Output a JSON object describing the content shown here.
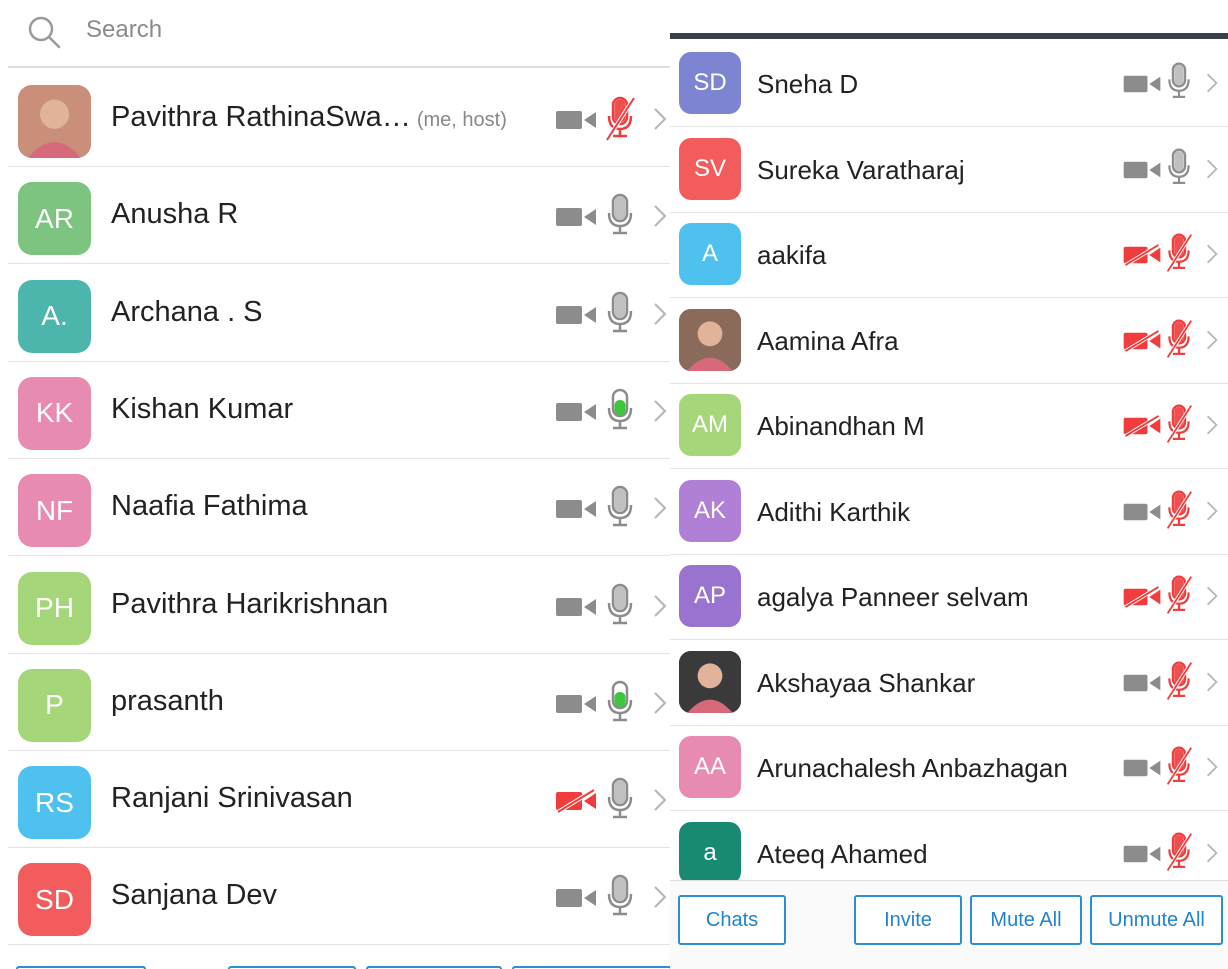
{
  "search": {
    "placeholder": "Search"
  },
  "left_participants": [
    {
      "initials": "",
      "photo": true,
      "name": "Pavithra RathinaSwa…",
      "tag": "(me, host)",
      "color": "#c98f7a",
      "video_off": false,
      "mic": "muted"
    },
    {
      "initials": "AR",
      "name": "Anusha R",
      "color": "#7cc47f",
      "video_off": false,
      "mic": "on"
    },
    {
      "initials": "A.",
      "name": "Archana . S",
      "color": "#4db6ac",
      "video_off": false,
      "mic": "on"
    },
    {
      "initials": "KK",
      "name": "Kishan Kumar",
      "color": "#e88bb3",
      "video_off": false,
      "mic": "speaking"
    },
    {
      "initials": "NF",
      "name": "Naafia Fathima",
      "color": "#e88bb3",
      "video_off": false,
      "mic": "on"
    },
    {
      "initials": "PH",
      "name": "Pavithra Harikrishnan",
      "color": "#a5d67a",
      "video_off": false,
      "mic": "on"
    },
    {
      "initials": "P",
      "name": "prasanth",
      "color": "#a5d67a",
      "video_off": false,
      "mic": "speaking"
    },
    {
      "initials": "RS",
      "name": "Ranjani Srinivasan",
      "color": "#4fc1ef",
      "video_off": true,
      "mic": "on"
    },
    {
      "initials": "SD",
      "name": "Sanjana Dev",
      "color": "#f25c5c",
      "video_off": false,
      "mic": "on"
    }
  ],
  "right_participants": [
    {
      "initials": "SD",
      "name": "Sneha D",
      "color": "#7d85d3",
      "video_off": false,
      "mic": "on"
    },
    {
      "initials": "SV",
      "name": "Sureka Varatharaj",
      "color": "#f25c5c",
      "video_off": false,
      "mic": "on"
    },
    {
      "initials": "A",
      "name": "aakifa",
      "color": "#4fc1ef",
      "video_off": true,
      "mic": "muted"
    },
    {
      "initials": "",
      "photo": true,
      "name": "Aamina Afra",
      "color": "#8a6a5a",
      "video_off": true,
      "mic": "muted"
    },
    {
      "initials": "AM",
      "name": "Abinandhan M",
      "color": "#a5d67a",
      "video_off": true,
      "mic": "muted"
    },
    {
      "initials": "AK",
      "name": "Adithi Karthik",
      "color": "#b07fd6",
      "video_off": false,
      "mic": "muted"
    },
    {
      "initials": "AP",
      "name": "agalya Panneer selvam",
      "color": "#9a72cf",
      "video_off": true,
      "mic": "muted"
    },
    {
      "initials": "",
      "photo": true,
      "name": "Akshayaa Shankar",
      "color": "#3a3a3a",
      "video_off": false,
      "mic": "muted"
    },
    {
      "initials": "AA",
      "name": "Arunachalesh Anbazhagan",
      "color": "#e88bb3",
      "video_off": false,
      "mic": "muted"
    },
    {
      "initials": "a",
      "name": "Ateeq Ahamed",
      "color": "#188a72",
      "video_off": false,
      "mic": "muted"
    }
  ],
  "footer": {
    "chats": "Chats",
    "invite": "Invite",
    "mute_all": "Mute All",
    "unmute_all": "Unmute All"
  },
  "colors": {
    "icon_gray": "#8c8c8c",
    "muted_red": "#f03c3c",
    "speaking_green": "#3cc83c",
    "button_blue": "#2a8fd4"
  }
}
